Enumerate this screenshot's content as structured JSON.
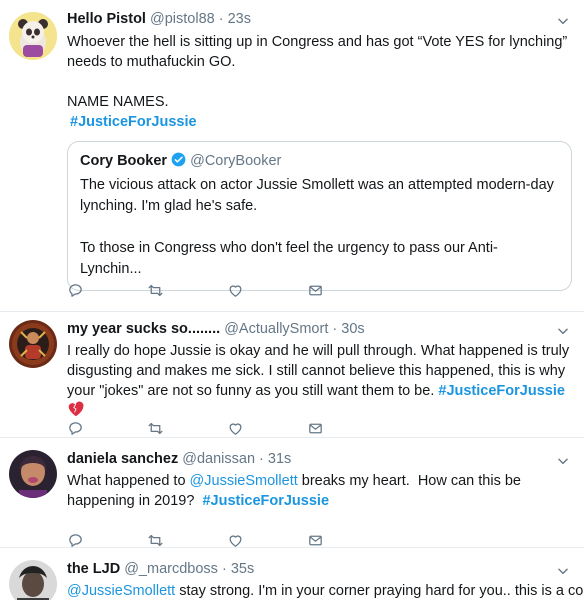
{
  "tweets": [
    {
      "name": "Hello Pistol",
      "handle": "@pistol88",
      "dot": "·",
      "time": "23s",
      "text": "Whoever the hell is sitting up in Congress and has got “Vote YES for lynching” needs to muthafuckin GO.\n\nNAME NAMES.",
      "hashtag": "#JusticeForJussie",
      "quote": {
        "name": "Cory Booker",
        "handle": "@CoryBooker",
        "text": "The vicious attack on actor Jussie Smollett was an attempted modern-day lynching. I'm glad he's safe.\n\nTo those in Congress who don't feel the urgency to pass our Anti-Lynchin..."
      }
    },
    {
      "name": "my year sucks so........",
      "handle": "@ActuallySmort",
      "dot": "·",
      "time": "30s",
      "text": "I really do hope Jussie is okay and he will pull through. What happened is truly disgusting and makes me sick. I still cannot believe this happened, this is why your \"jokes\" are not so funny as you still want them to be.",
      "hashtag": "#JusticeForJussie",
      "emoji": "broken-heart"
    },
    {
      "name": "daniela sanchez",
      "handle": "@danissan",
      "dot": "·",
      "time": "31s",
      "text_before": "What happened to ",
      "mention": "@JussieSmollett",
      "text_after": " breaks my heart.  How can this be happening in 2019?",
      "hashtag": "#JusticeForJussie"
    },
    {
      "name": "the LJD",
      "handle": "@_marcdboss",
      "dot": "·",
      "time": "35s",
      "mention": "@JussieSmollett",
      "text_after": " stay strong. I'm in your corner praying hard for you.. this is a cold"
    }
  ],
  "icons": {
    "reply": "reply-icon",
    "retweet": "retweet-icon",
    "like": "like-icon",
    "dm": "direct-message-icon",
    "more": "chevron-down-icon",
    "verified": "verified-badge-icon"
  },
  "colors": {
    "link": "#1b95e0",
    "secondary": "#657786",
    "border": "#e6ecf0",
    "verified": "#1da1f2",
    "broken_heart": "#e0245e"
  }
}
